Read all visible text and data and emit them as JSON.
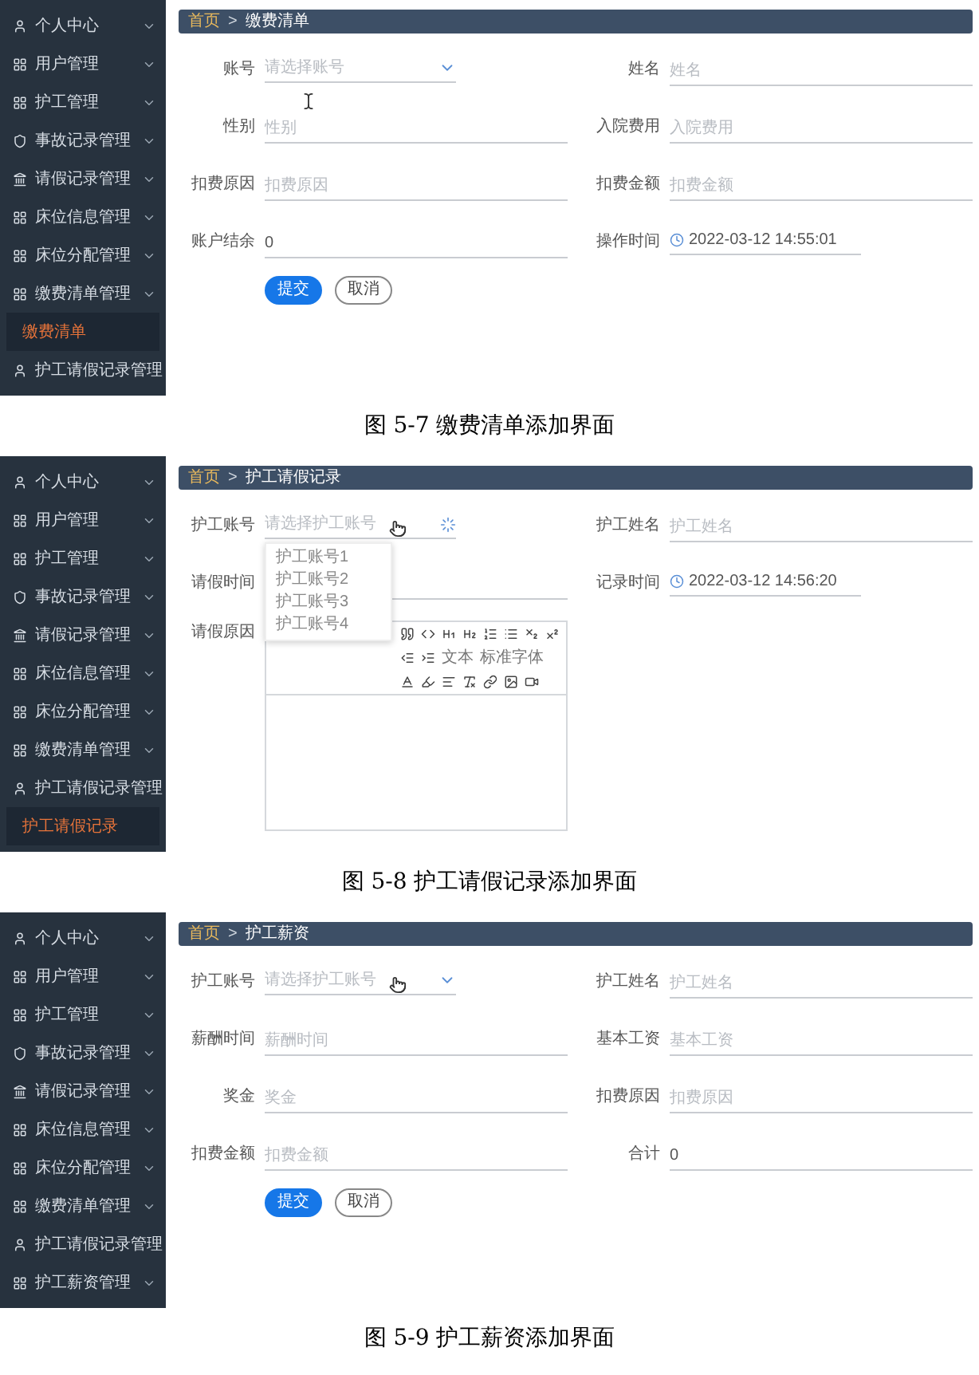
{
  "figures": [
    {
      "sidebar": [
        {
          "label": "个人中心",
          "kind": "user",
          "chevron": true,
          "selected": false
        },
        {
          "label": "用户管理",
          "kind": "grid",
          "chevron": true,
          "selected": false
        },
        {
          "label": "护工管理",
          "kind": "grid",
          "chevron": true,
          "selected": false
        },
        {
          "label": "事故记录管理",
          "kind": "shield",
          "chevron": true,
          "selected": false
        },
        {
          "label": "请假记录管理",
          "kind": "bank",
          "chevron": true,
          "selected": false
        },
        {
          "label": "床位信息管理",
          "kind": "grid",
          "chevron": true,
          "selected": false
        },
        {
          "label": "床位分配管理",
          "kind": "grid",
          "chevron": true,
          "selected": false
        },
        {
          "label": "缴费清单管理",
          "kind": "grid",
          "chevron": true,
          "selected": false
        },
        {
          "label": "缴费清单",
          "kind": "sub",
          "chevron": false,
          "selected": true
        },
        {
          "label": "护工请假记录管理",
          "kind": "user",
          "chevron": false,
          "selected": false
        }
      ],
      "breadcrumb": {
        "home": "首页",
        "separator": ">",
        "current": "缴费清单"
      },
      "rows": [
        [
          {
            "label": "账号",
            "kind": "select",
            "placeholder": "请选择账号"
          },
          {
            "label": "姓名",
            "kind": "text",
            "placeholder": "姓名"
          }
        ],
        [
          {
            "label": "性别",
            "kind": "text",
            "placeholder": "性别"
          },
          {
            "label": "入院费用",
            "kind": "text",
            "placeholder": "入院费用"
          }
        ],
        [
          {
            "label": "扣费原因",
            "kind": "text",
            "placeholder": "扣费原因"
          },
          {
            "label": "扣费金额",
            "kind": "text",
            "placeholder": "扣费金额"
          }
        ],
        [
          {
            "label": "账户结余",
            "kind": "text",
            "value": "0"
          },
          {
            "label": "操作时间",
            "kind": "datetime",
            "value": "2022-03-12 14:55:01"
          }
        ]
      ],
      "buttons": [
        {
          "label": "提交",
          "kind": "primary"
        },
        {
          "label": "取消",
          "kind": "default"
        }
      ],
      "caption": "图 5-7 缴费清单添加界面"
    },
    {
      "sidebar": [
        {
          "label": "个人中心",
          "kind": "user",
          "chevron": true,
          "selected": false
        },
        {
          "label": "用户管理",
          "kind": "grid",
          "chevron": true,
          "selected": false
        },
        {
          "label": "护工管理",
          "kind": "grid",
          "chevron": true,
          "selected": false
        },
        {
          "label": "事故记录管理",
          "kind": "shield",
          "chevron": true,
          "selected": false
        },
        {
          "label": "请假记录管理",
          "kind": "bank",
          "chevron": true,
          "selected": false
        },
        {
          "label": "床位信息管理",
          "kind": "grid",
          "chevron": true,
          "selected": false
        },
        {
          "label": "床位分配管理",
          "kind": "grid",
          "chevron": true,
          "selected": false
        },
        {
          "label": "缴费清单管理",
          "kind": "grid",
          "chevron": true,
          "selected": false
        },
        {
          "label": "护工请假记录管理",
          "kind": "user",
          "chevron": false,
          "selected": false
        },
        {
          "label": "护工请假记录",
          "kind": "sub",
          "chevron": false,
          "selected": true
        }
      ],
      "breadcrumb": {
        "home": "首页",
        "separator": ">",
        "current": "护工请假记录"
      },
      "rows": [
        [
          {
            "label": "护工账号",
            "kind": "loading-select",
            "placeholder": "请选择护工账号",
            "options": [
              "护工账号1",
              "护工账号2",
              "护工账号3",
              "护工账号4"
            ]
          },
          {
            "label": "护工姓名",
            "kind": "text",
            "placeholder": "护工姓名"
          }
        ],
        [
          {
            "label": "请假时间",
            "kind": "text"
          },
          {
            "label": "记录时间",
            "kind": "datetime",
            "value": "2022-03-12 14:56:20"
          }
        ],
        [
          {
            "label": "请假原因",
            "kind": "editor",
            "selects": [
              "文本",
              "标准字体"
            ]
          }
        ]
      ],
      "caption": "图 5-8 护工请假记录添加界面"
    },
    {
      "sidebar": [
        {
          "label": "个人中心",
          "kind": "user",
          "chevron": true,
          "selected": false
        },
        {
          "label": "用户管理",
          "kind": "grid",
          "chevron": true,
          "selected": false
        },
        {
          "label": "护工管理",
          "kind": "grid",
          "chevron": true,
          "selected": false
        },
        {
          "label": "事故记录管理",
          "kind": "shield",
          "chevron": true,
          "selected": false
        },
        {
          "label": "请假记录管理",
          "kind": "bank",
          "chevron": true,
          "selected": false
        },
        {
          "label": "床位信息管理",
          "kind": "grid",
          "chevron": true,
          "selected": false
        },
        {
          "label": "床位分配管理",
          "kind": "grid",
          "chevron": true,
          "selected": false
        },
        {
          "label": "缴费清单管理",
          "kind": "grid",
          "chevron": true,
          "selected": false
        },
        {
          "label": "护工请假记录管理",
          "kind": "user",
          "chevron": false,
          "selected": false
        },
        {
          "label": "护工薪资管理",
          "kind": "grid",
          "chevron": true,
          "selected": false
        }
      ],
      "breadcrumb": {
        "home": "首页",
        "separator": ">",
        "current": "护工薪资"
      },
      "rows": [
        [
          {
            "label": "护工账号",
            "kind": "select",
            "placeholder": "请选择护工账号"
          },
          {
            "label": "护工姓名",
            "kind": "text",
            "placeholder": "护工姓名"
          }
        ],
        [
          {
            "label": "薪酬时间",
            "kind": "text",
            "placeholder": "薪酬时间"
          },
          {
            "label": "基本工资",
            "kind": "text",
            "placeholder": "基本工资"
          }
        ],
        [
          {
            "label": "奖金",
            "kind": "text",
            "placeholder": "奖金"
          },
          {
            "label": "扣费原因",
            "kind": "text",
            "placeholder": "扣费原因"
          }
        ],
        [
          {
            "label": "扣费金额",
            "kind": "text",
            "placeholder": "扣费金额"
          },
          {
            "label": "合计",
            "kind": "text",
            "value": "0"
          }
        ]
      ],
      "buttons": [
        {
          "label": "提交",
          "kind": "primary"
        },
        {
          "label": "取消",
          "kind": "default"
        }
      ],
      "caption": "图 5-9 护工薪资添加界面"
    }
  ]
}
